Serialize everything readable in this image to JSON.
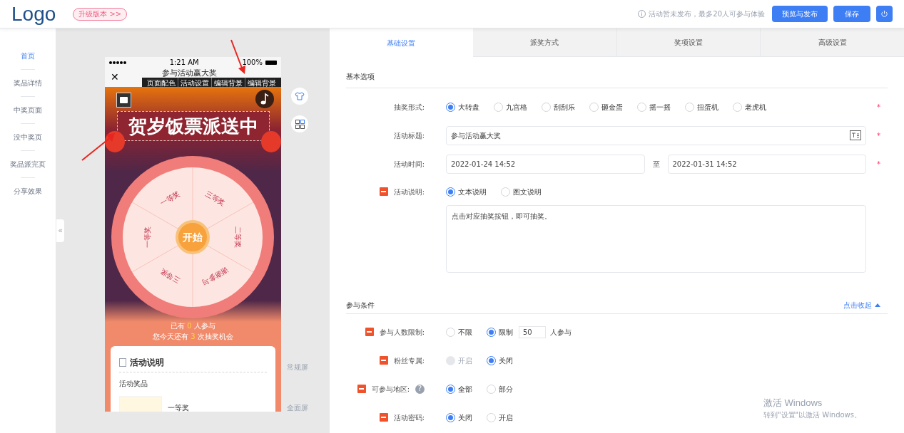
{
  "header": {
    "logo": "Logo",
    "upgrade": "升级版本 >>",
    "notice": "活动暂未发布，最多20人可参与体验",
    "buttons": [
      "预览与发布",
      "保存"
    ]
  },
  "sidebar": {
    "items": [
      {
        "label": "首页",
        "selected": true
      },
      {
        "label": "奖品详情",
        "selected": false
      },
      {
        "label": "中奖页面",
        "selected": false
      },
      {
        "label": "没中奖页",
        "selected": false
      },
      {
        "label": "奖品派完页",
        "selected": false
      },
      {
        "label": "分享效果",
        "selected": false
      }
    ],
    "collapse": "«"
  },
  "preview": {
    "time": "1:21 AM",
    "battery": "100%",
    "nav_title": "参与活动赢大奖",
    "close": "✕",
    "toolbar": [
      "页面配色",
      "活动设置",
      "编辑背景",
      "编辑背景"
    ],
    "banner": "贺岁饭票派送中",
    "wheel": [
      "三等奖",
      "二等奖",
      "谢谢参与",
      "三等奖",
      "一等奖",
      "一等奖"
    ],
    "start": "开始",
    "stats": [
      {
        "before": "已有",
        "count": "0",
        "after": "人参与"
      },
      {
        "before": "您今天还有",
        "count": "3",
        "after": "次抽奖机会"
      }
    ],
    "card": {
      "title": "活动说明",
      "section": "活动奖品",
      "prize": "一等奖"
    },
    "screen_labels": [
      "常规屏",
      "全面屏"
    ]
  },
  "tabs": [
    {
      "label": "基础设置",
      "selected": true
    },
    {
      "label": "派奖方式",
      "selected": false
    },
    {
      "label": "奖项设置",
      "selected": false
    },
    {
      "label": "高级设置",
      "selected": false
    }
  ],
  "basic": {
    "title": "基本选项",
    "rows": [
      {
        "kind": "radio",
        "label": "抽奖形式:",
        "required": "*",
        "flagged": false,
        "options": [
          {
            "label": "大转盘",
            "selected": true
          },
          {
            "label": "九宫格",
            "selected": false
          },
          {
            "label": "刮刮乐",
            "selected": false
          },
          {
            "label": "砸金蛋",
            "selected": false
          },
          {
            "label": "摇一摇",
            "selected": false
          },
          {
            "label": "扭蛋机",
            "selected": false
          },
          {
            "label": "老虎机",
            "selected": false
          }
        ]
      },
      {
        "kind": "input",
        "label": "活动标题:",
        "required": "*",
        "flagged": false,
        "value": "参与活动赢大奖"
      },
      {
        "kind": "daterange",
        "label": "活动时间:",
        "required": "*",
        "flagged": false,
        "start": "2022-01-24 14:52",
        "separator": "至",
        "end": "2022-01-31 14:52"
      },
      {
        "kind": "description",
        "label": "活动说明:",
        "flagged": true,
        "options": [
          {
            "label": "文本说明",
            "selected": true
          },
          {
            "label": "图文说明",
            "selected": false
          }
        ],
        "text": "点击对应抽奖按钮，即可抽奖。"
      }
    ]
  },
  "participation": {
    "title": "参与条件",
    "toggle": "点击收起",
    "expanded": true,
    "rows": [
      {
        "kind": "limit",
        "label": "参与人数限制:",
        "flagged": true,
        "options": [
          {
            "label": "不限",
            "selected": false
          },
          {
            "label": "限制",
            "selected": true
          }
        ],
        "value": "50",
        "suffix": "人参与"
      },
      {
        "kind": "radio",
        "label": "粉丝专属:",
        "flagged": true,
        "options": [
          {
            "label": "开启",
            "selected": false,
            "disabled": true
          },
          {
            "label": "关闭",
            "selected": true
          }
        ]
      },
      {
        "kind": "radio",
        "label": "可参与地区:",
        "flagged": true,
        "help": "?",
        "options": [
          {
            "label": "全部",
            "selected": true
          },
          {
            "label": "部分",
            "selected": false
          }
        ]
      },
      {
        "kind": "radio",
        "label": "活动密码:",
        "flagged": true,
        "options": [
          {
            "label": "关闭",
            "selected": true
          },
          {
            "label": "开启",
            "selected": false
          }
        ]
      }
    ]
  },
  "os_notice": [
    "激活 Windows",
    "转到\"设置\"以激活 Windows。"
  ]
}
